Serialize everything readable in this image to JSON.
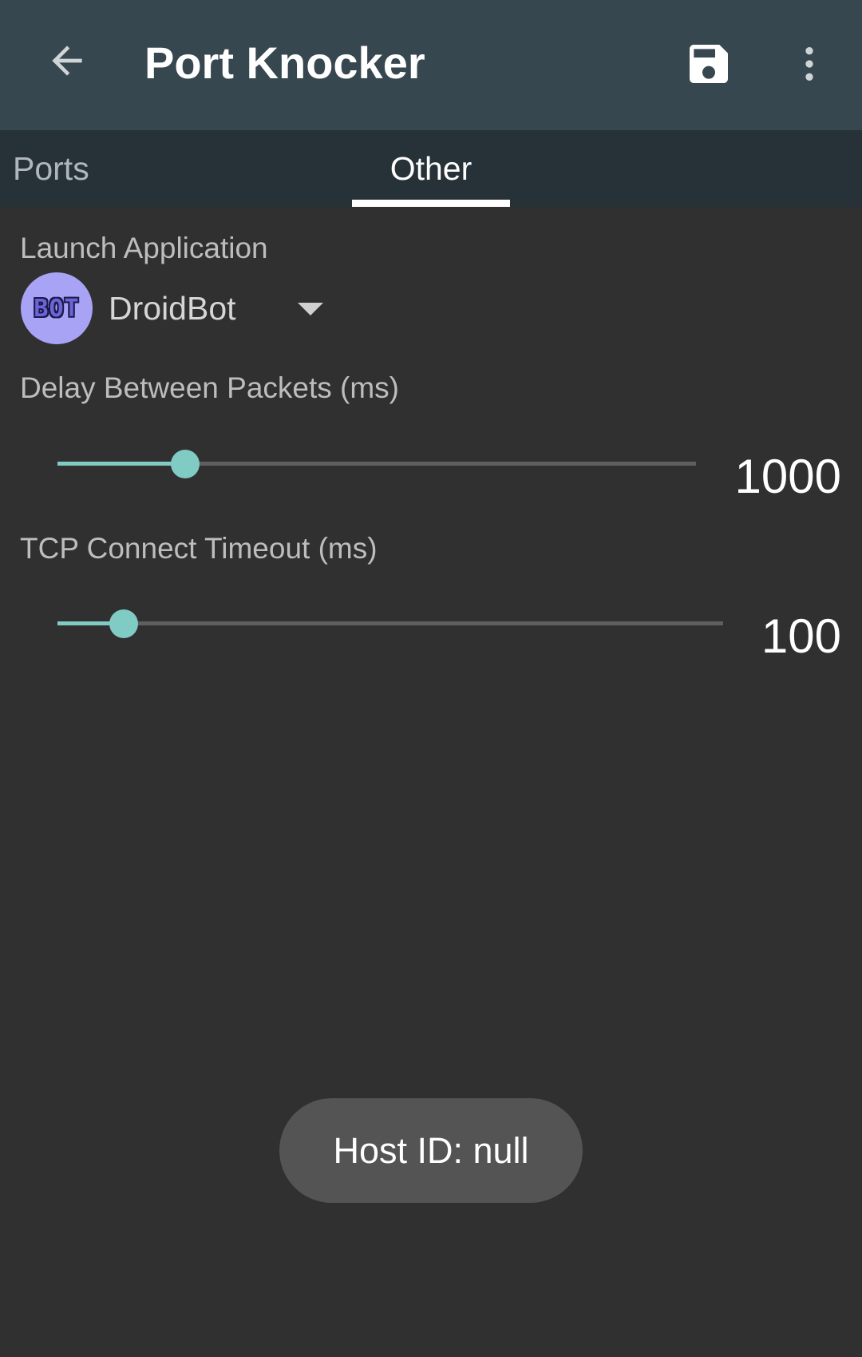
{
  "appbar": {
    "title": "Port Knocker",
    "back_icon": "arrow-back-icon",
    "save_icon": "save-icon",
    "menu_icon": "more-vert-icon"
  },
  "tabs": [
    {
      "label": "Ports",
      "selected": false
    },
    {
      "label": "Other",
      "selected": true
    }
  ],
  "launch": {
    "label": "Launch Application",
    "app_name": "DroidBot",
    "app_icon_text": "BOT"
  },
  "delay": {
    "label": "Delay Between Packets (ms)",
    "value": "1000",
    "slider_fraction": 0.2
  },
  "timeout": {
    "label": "TCP Connect Timeout (ms)",
    "value": "100",
    "slider_fraction": 0.1
  },
  "toast": {
    "text": "Host ID: null"
  },
  "colors": {
    "appbar": "#37474f",
    "tabbar": "#263238",
    "accent": "#80cbc4",
    "background": "#303030"
  }
}
